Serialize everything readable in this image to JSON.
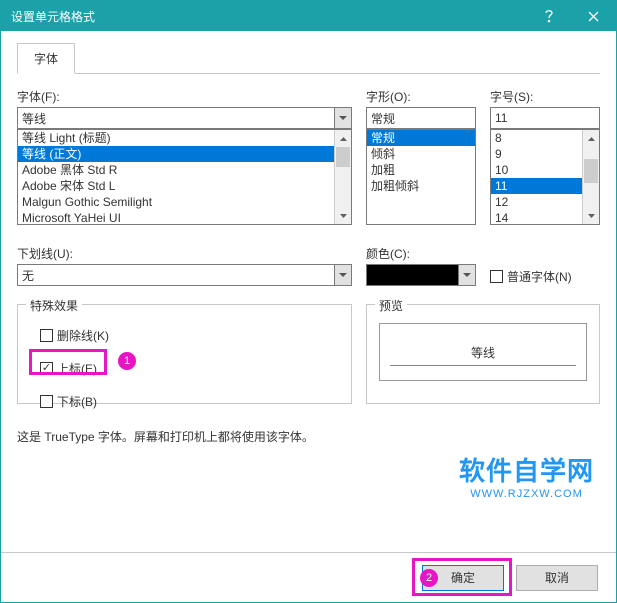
{
  "dialog": {
    "title": "设置单元格格式"
  },
  "tabs": {
    "active": "字体"
  },
  "font": {
    "label": "字体(F):",
    "value": "等线",
    "options": [
      "等线 Light (标题)",
      "等线 (正文)",
      "Adobe 黑体 Std R",
      "Adobe 宋体 Std L",
      "Malgun Gothic Semilight",
      "Microsoft YaHei UI"
    ],
    "selected": "等线 (正文)"
  },
  "style": {
    "label": "字形(O):",
    "value": "常规",
    "options": [
      "常规",
      "倾斜",
      "加粗",
      "加粗倾斜"
    ],
    "selected": "常规"
  },
  "size": {
    "label": "字号(S):",
    "value": "11",
    "options": [
      "8",
      "9",
      "10",
      "11",
      "12",
      "14"
    ],
    "selected": "11"
  },
  "underline": {
    "label": "下划线(U):",
    "value": "无"
  },
  "color": {
    "label": "颜色(C):",
    "value": "#000000"
  },
  "normalFont": {
    "label": "普通字体(N)",
    "checked": false
  },
  "effects": {
    "legend": "特殊效果",
    "strike": {
      "label": "删除线(K)",
      "checked": false
    },
    "super": {
      "label": "上标(E)",
      "checked": true
    },
    "sub": {
      "label": "下标(B)",
      "checked": false
    }
  },
  "preview": {
    "legend": "预览",
    "text": "等线"
  },
  "note": "这是 TrueType 字体。屏幕和打印机上都将使用该字体。",
  "watermark": {
    "big": "软件自学网",
    "small": "WWW.RJZXW.COM"
  },
  "buttons": {
    "ok": "确定",
    "cancel": "取消"
  },
  "annotations": {
    "a1": "1",
    "a2": "2"
  }
}
